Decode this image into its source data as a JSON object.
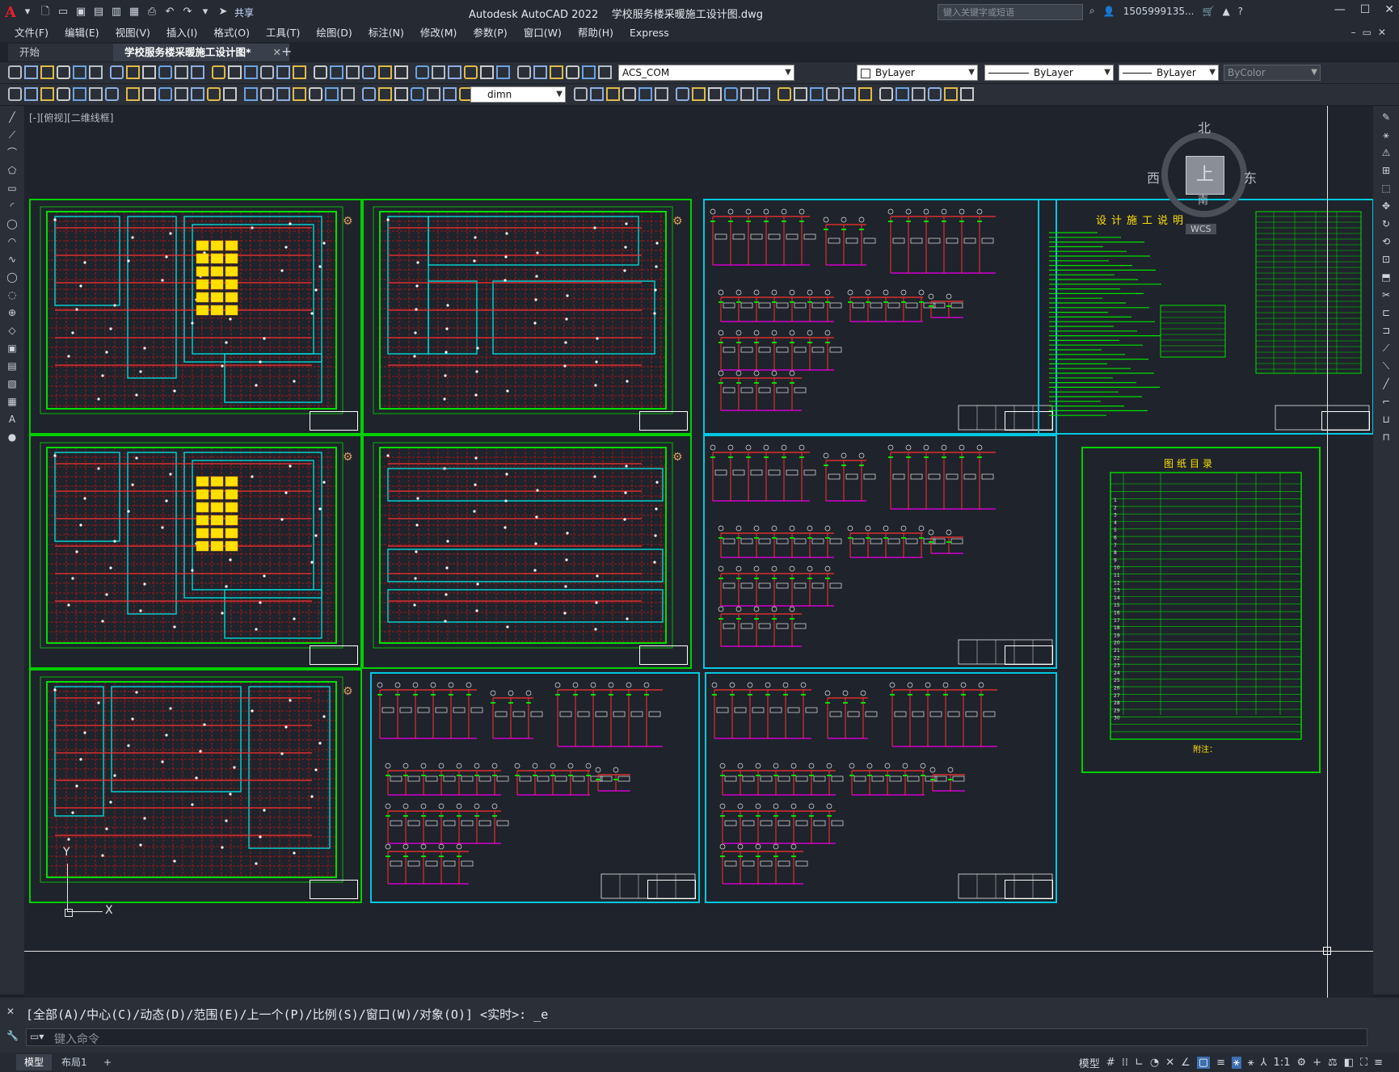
{
  "title_bar": {
    "app_logo": "A",
    "share_label": "共享",
    "title": "Autodesk AutoCAD 2022    学校服务楼采暖施工设计图.dwg",
    "search_placeholder": "键入关键字或短语",
    "user": "1505999135...",
    "window_buttons": [
      "—",
      "☐",
      "✕"
    ]
  },
  "menu": [
    "文件(F)",
    "编辑(E)",
    "视图(V)",
    "插入(I)",
    "格式(O)",
    "工具(T)",
    "绘图(D)",
    "标注(N)",
    "修改(M)",
    "参数(P)",
    "窗口(W)",
    "帮助(H)",
    "Express"
  ],
  "doc_tabs": {
    "start": "开始",
    "active": "学校服务楼采暖施工设计图*",
    "close": "✕",
    "add": "+"
  },
  "toolbar1": {
    "layer": "ACS_COM",
    "color": "ByLayer",
    "linetype": "ByLayer",
    "lineweight": "ByLayer",
    "plotstyle": "ByColor"
  },
  "toolbar2": {
    "dimstyle": "dimn"
  },
  "viewport_label": "[-][俯视][二维线框]",
  "navcube": {
    "north": "北",
    "south": "南",
    "east": "东",
    "west": "西",
    "top": "上",
    "wcs": "WCS"
  },
  "ucs": {
    "x": "X",
    "y": "Y"
  },
  "sheets": {
    "design_notes_title": "设计施工说明",
    "drawing_list_title": "图纸目录",
    "drawing_list_remark": "附注："
  },
  "command": {
    "history": "[全部(A)/中心(C)/动态(D)/范围(E)/上一个(P)/比例(S)/窗口(W)/对象(O)] <实时>: _e",
    "placeholder": "键入命令"
  },
  "status": {
    "model_tab": "模型",
    "layout_tab": "布局1",
    "add": "+",
    "model_btn": "模型",
    "scale": "1:1"
  },
  "colors": {
    "bg": "#1f232b",
    "sheet_green": "#00d000",
    "sheet_cyan": "#00c8e0",
    "grid_red": "#c81414",
    "yellow": "#ffe000"
  }
}
